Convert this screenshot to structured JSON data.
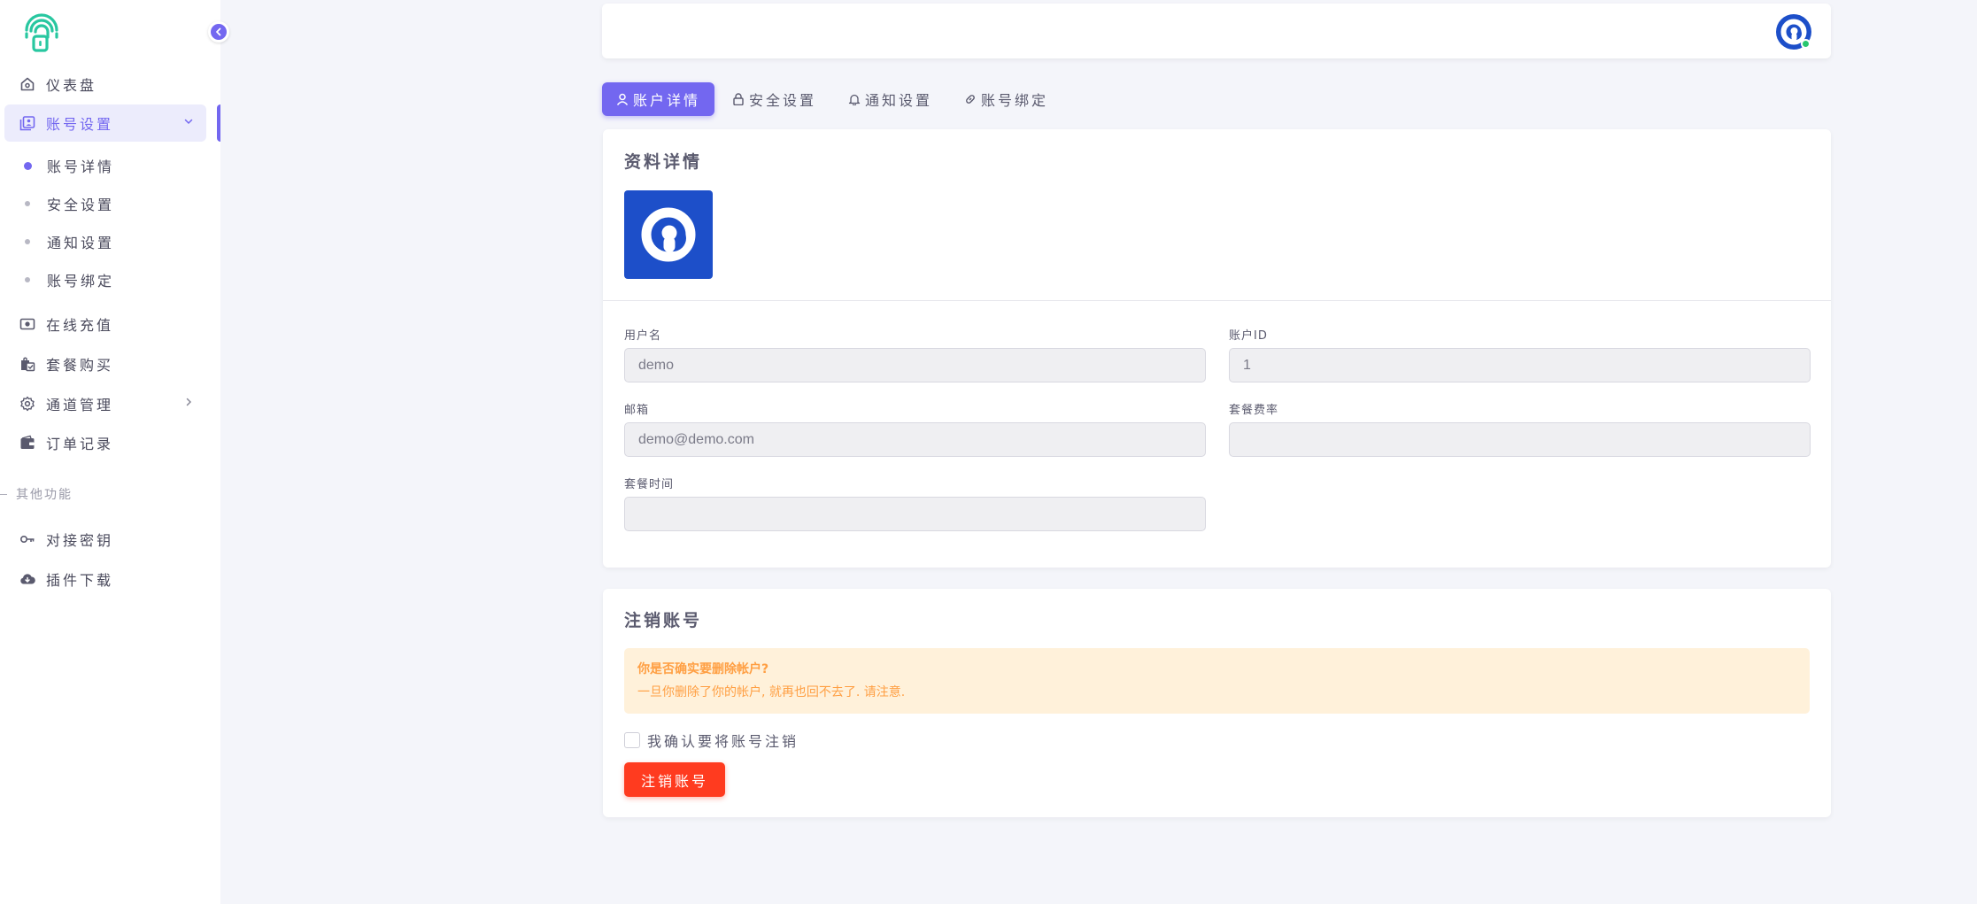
{
  "sidebar": {
    "logo_icon": "fingerprint-lock-logo",
    "nav": {
      "dashboard": "仪表盘",
      "account_settings": "账号设置",
      "recharge": "在线充值",
      "package_purchase": "套餐购买",
      "channel_management": "通道管理",
      "order_records": "订单记录",
      "api_keys": "对接密钥",
      "plugin_download": "插件下载"
    },
    "sub": {
      "account_details": "账号详情",
      "security": "安全设置",
      "notifications": "通知设置",
      "binding": "账号绑定"
    },
    "section_other": "其他功能"
  },
  "tabs": {
    "account_details": "账户详情",
    "security": "安全设置",
    "notifications": "通知设置",
    "binding": "账号绑定"
  },
  "profile": {
    "title": "资料详情",
    "username_label": "用户名",
    "username_value": "demo",
    "account_id_label": "账户ID",
    "account_id_value": "1",
    "email_label": "邮箱",
    "email_value": "demo@demo.com",
    "package_rate_label": "套餐费率",
    "package_rate_value": "",
    "package_time_label": "套餐时间",
    "package_time_value": ""
  },
  "deactivate": {
    "title": "注销账号",
    "warning_title": "你是否确实要删除帐户?",
    "warning_text": "一旦你删除了你的帐户, 就再也回不去了. 请注意.",
    "confirm_label": "我确认要将账号注销",
    "button_label": "注销账号"
  },
  "colors": {
    "primary": "#7367f0",
    "danger": "#ff3b1f",
    "warning": "#ff9f43",
    "logo": "#28c7a0"
  }
}
